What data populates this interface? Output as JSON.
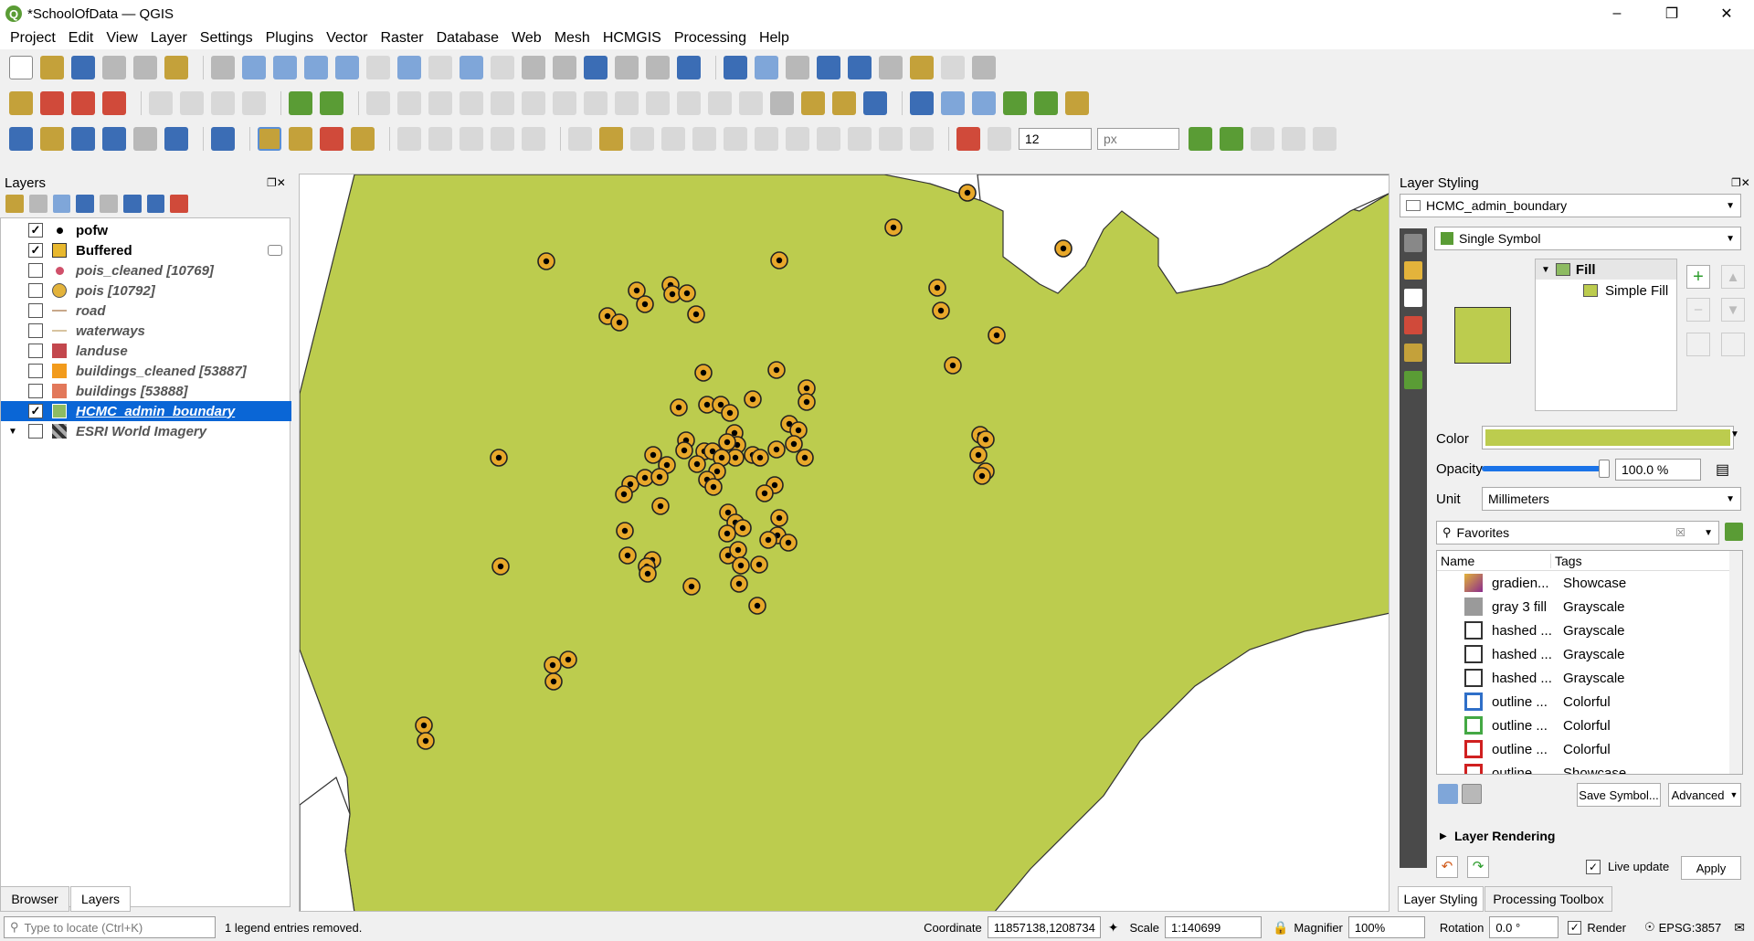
{
  "window": {
    "title": "*SchoolOfData — QGIS",
    "logo": "Q"
  },
  "menu": [
    "Project",
    "Edit",
    "View",
    "Layer",
    "Settings",
    "Plugins",
    "Vector",
    "Raster",
    "Database",
    "Web",
    "Mesh",
    "HCMGIS",
    "Processing",
    "Help"
  ],
  "toolbar": {
    "font_size_value": "12",
    "unit_value": "px"
  },
  "layers_panel": {
    "title": "Layers",
    "items": [
      {
        "name": "pofw",
        "checked": true,
        "symbol": "dot",
        "color": "#000000",
        "bold": true
      },
      {
        "name": "Buffered",
        "checked": true,
        "symbol": "fill",
        "color": "#e8b82e",
        "bold": true
      },
      {
        "name": "pois_cleaned [10769]",
        "checked": false,
        "symbol": "point",
        "color": "#d0506a",
        "bold": false
      },
      {
        "name": "pois [10792]",
        "checked": false,
        "symbol": "circle",
        "color": "#e3b33b",
        "bold": false
      },
      {
        "name": "road",
        "checked": false,
        "symbol": "line",
        "color": "#c8a88a",
        "bold": false
      },
      {
        "name": "waterways",
        "checked": false,
        "symbol": "line",
        "color": "#d8c4a0",
        "bold": false
      },
      {
        "name": "landuse",
        "checked": false,
        "symbol": "fill",
        "color": "#c3474d",
        "bold": false
      },
      {
        "name": "buildings_cleaned [53887]",
        "checked": false,
        "symbol": "fill",
        "color": "#f29b1c",
        "bold": false
      },
      {
        "name": "buildings [53888]",
        "checked": false,
        "symbol": "fill",
        "color": "#e2785a",
        "bold": false
      },
      {
        "name": "HCMC_admin_boundary",
        "checked": true,
        "symbol": "fill",
        "color": "#8dbb62",
        "bold": true,
        "selected": true
      },
      {
        "name": "ESRI World Imagery",
        "checked": false,
        "symbol": "raster",
        "color": "#444444",
        "bold": false
      }
    ],
    "tabs": [
      "Browser",
      "Layers"
    ]
  },
  "map": {
    "fill_color": "#bccc4e",
    "point_fill": "#e8a82a"
  },
  "styling_panel": {
    "title": "Layer Styling",
    "layer_combo": "HCMC_admin_boundary",
    "renderer_combo": "Single Symbol",
    "tree_fill_label": "Fill",
    "tree_simple_fill_label": "Simple Fill",
    "preview_color": "#bccc4e",
    "color_label": "Color",
    "opacity_label": "Opacity",
    "opacity_value": "100.0 %",
    "opacity_fraction": 1.0,
    "unit_label": "Unit",
    "unit_value": "Millimeters",
    "search_value": "Favorites",
    "col_name": "Name",
    "col_tags": "Tags",
    "symbols": [
      {
        "name": "gradien...",
        "tag": "Showcase",
        "color": "#8c2c8c"
      },
      {
        "name": "gray 3 fill",
        "tag": "Grayscale",
        "color": "#9a9a9a"
      },
      {
        "name": "hashed ...",
        "tag": "Grayscale",
        "color": "#333333"
      },
      {
        "name": "hashed ...",
        "tag": "Grayscale",
        "color": "#333333"
      },
      {
        "name": "hashed ...",
        "tag": "Grayscale",
        "color": "#333333"
      },
      {
        "name": "outline ...",
        "tag": "Colorful",
        "color": "#2f6fc8"
      },
      {
        "name": "outline ...",
        "tag": "Colorful",
        "color": "#44a844"
      },
      {
        "name": "outline ...",
        "tag": "Colorful",
        "color": "#d02020"
      },
      {
        "name": "outline ...",
        "tag": "Showcase",
        "color": "#d02020"
      }
    ],
    "save_symbol_label": "Save Symbol...",
    "advanced_label": "Advanced",
    "layer_rendering_label": "Layer Rendering",
    "live_update_label": "Live update",
    "apply_label": "Apply",
    "tabs": [
      "Layer Styling",
      "Processing Toolbox"
    ]
  },
  "statusbar": {
    "locate_placeholder": "Type to locate (Ctrl+K)",
    "message": "1 legend entries removed.",
    "coordinate_label": "Coordinate",
    "coordinate_value": "11857138,1208734",
    "scale_label": "Scale",
    "scale_value": "1:140699",
    "magnifier_label": "Magnifier",
    "magnifier_value": "100%",
    "rotation_label": "Rotation",
    "rotation_value": "0.0 °",
    "render_label": "Render",
    "crs_label": "EPSG:3857"
  }
}
